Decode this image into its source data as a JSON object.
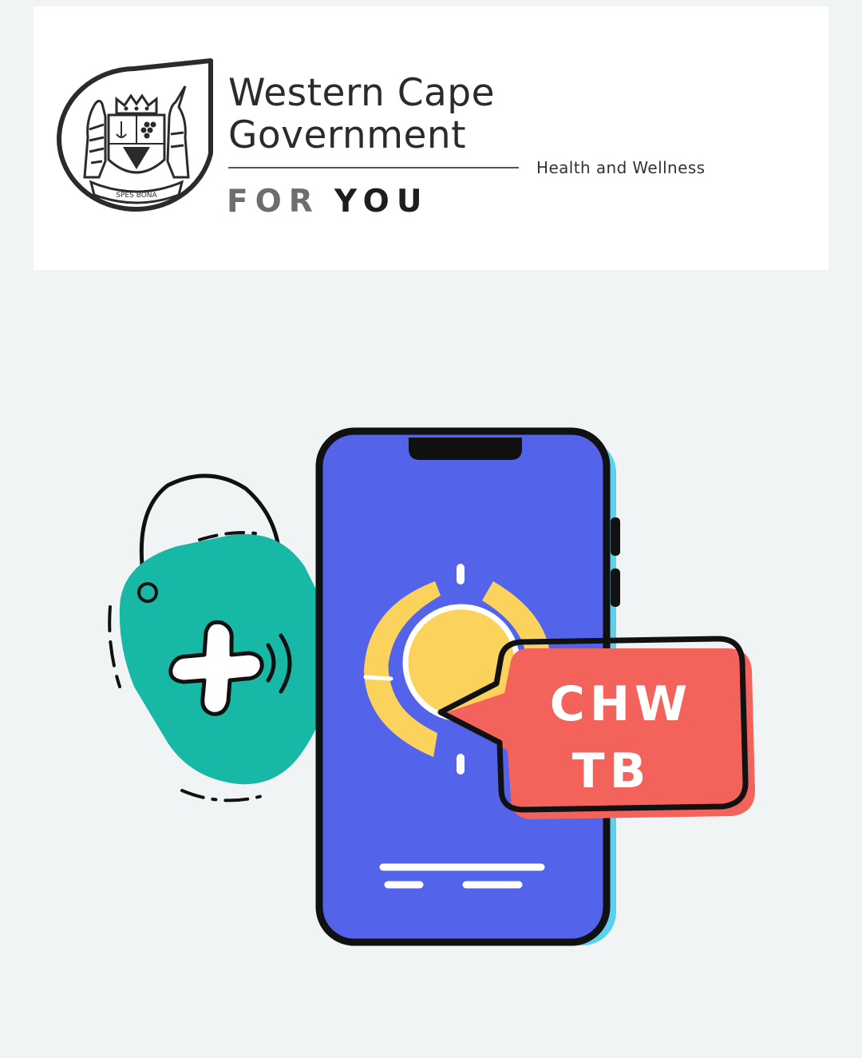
{
  "header": {
    "title_line1": "Western Cape",
    "title_line2": "Government",
    "tagline_for": "FOR",
    "tagline_you": "YOU",
    "department": "Health and Wellness",
    "crest_motto": "SPES BONA"
  },
  "illustration": {
    "bubble_line1": "CHW",
    "bubble_line2": "TB"
  },
  "colors": {
    "background": "#f1f4f5",
    "phone_screen": "#5464ea",
    "tag_teal": "#17b8a6",
    "bubble_red": "#f4625c",
    "sun_yellow": "#fbd35c"
  }
}
